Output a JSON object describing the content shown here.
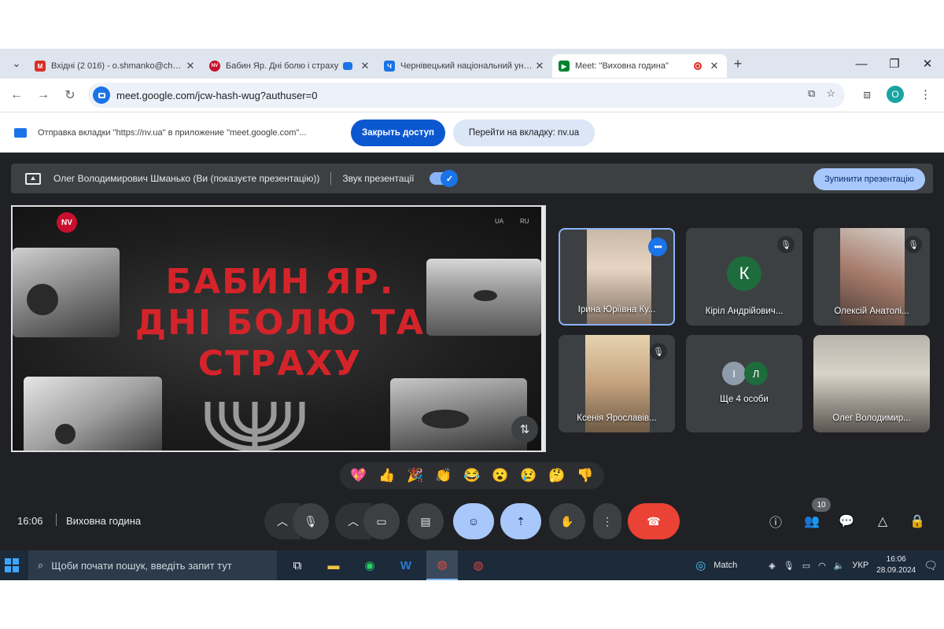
{
  "browser": {
    "tabs": [
      {
        "title": "Вхідні (2 016) - o.shmanko@chnu.edu.ua",
        "favicon": "gmail-icon",
        "color": "#d93025",
        "glyph": "M"
      },
      {
        "title": "Бабин Яр. Дні болю і страху",
        "favicon": "nv-icon",
        "color": "#c8102e",
        "glyph": "NV"
      },
      {
        "title": "Чернівецький національний університет",
        "favicon": "chnu-icon",
        "color": "#1a73e8",
        "glyph": "Ч"
      },
      {
        "title": "Meet: \"Виховна година\"",
        "favicon": "meet-icon",
        "color": "#00832d",
        "glyph": "▶"
      }
    ],
    "url": "meet.google.com/jcw-hash-wug?authuser=0",
    "profile_initial": "O"
  },
  "share_bar": {
    "text": "Отправка вкладки \"https://nv.ua\" в приложение \"meet.google.com\"...",
    "close_label": "Закрыть доступ",
    "goto_label": "Перейти на вкладку: nv.ua"
  },
  "presenting_bar": {
    "presenter": "Олег Володимирович Шманько (Ви (показуєте презентацію))",
    "audio_label": "Звук презентації",
    "stop_label": "Зупинити презентацію"
  },
  "slide": {
    "logo": "NV",
    "lang_ua": "UA",
    "lang_ru": "RU",
    "headline": "Бабин Яр. Дні болю та страху"
  },
  "participants": [
    {
      "name": "Ірина Юріївна Ку...",
      "has_video": true
    },
    {
      "name": "Кіріл Андрійович...",
      "initial": "К"
    },
    {
      "name": "Олексій Анатолі...",
      "has_video": true
    },
    {
      "name": "Ксенія Ярославів...",
      "has_video": true
    },
    {
      "name": "Ще 4 особи",
      "initials": [
        "І",
        "Л"
      ]
    },
    {
      "name": "Олег Володимир...",
      "has_video": true
    }
  ],
  "reactions": [
    "💖",
    "👍",
    "🎉",
    "👏",
    "😂",
    "😮",
    "😢",
    "🤔",
    "👎"
  ],
  "controls": {
    "time": "16:06",
    "meeting_title": "Виховна година",
    "people_count": "10"
  },
  "taskbar": {
    "search_placeholder": "Щоби почати пошук, введіть запит тут",
    "weather_label": "Match",
    "lang": "УКР",
    "time": "16:06",
    "date": "28.09.2024"
  }
}
